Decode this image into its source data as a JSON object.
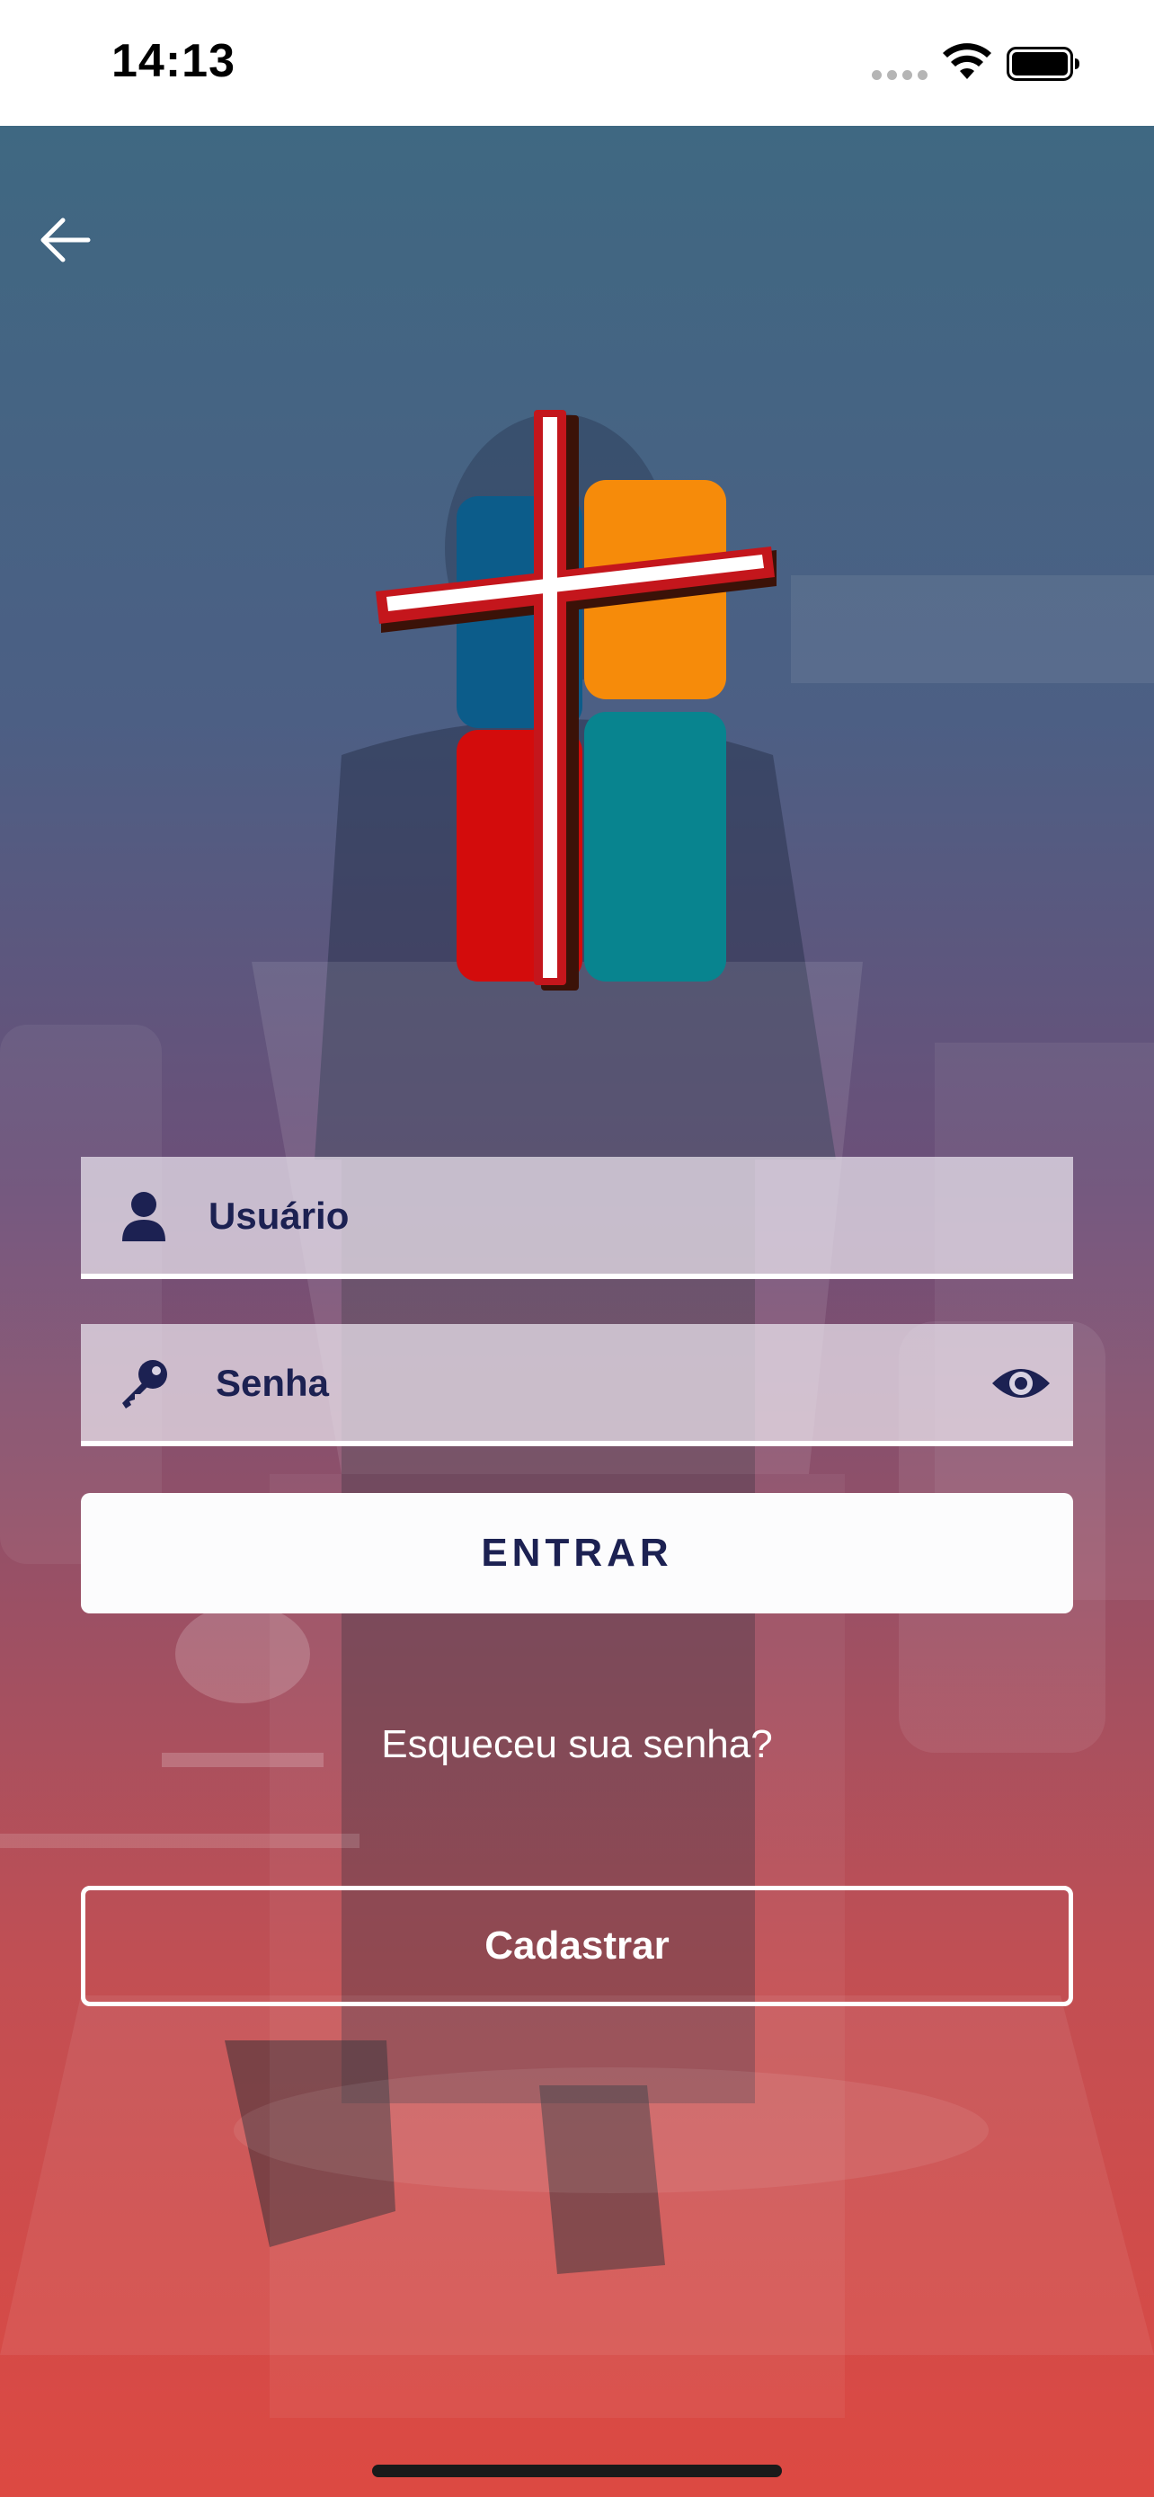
{
  "status_bar": {
    "time": "14:13"
  },
  "login": {
    "username_placeholder": "Usuário",
    "password_placeholder": "Senha",
    "enter_label": "ENTRAR",
    "forgot_label": "Esqueceu sua senha?",
    "register_label": "Cadastrar"
  },
  "icons": {
    "back": "arrow-left-icon",
    "user": "user-icon",
    "key": "key-icon",
    "eye": "eye-icon",
    "wifi": "wifi-icon",
    "battery": "battery-icon"
  },
  "colors": {
    "primary_text": "#1c2152",
    "gradient_top": "#3f6882",
    "gradient_bottom": "#dd4942",
    "logo_blue": "#0c5c8a",
    "logo_orange": "#f68b0a",
    "logo_red": "#d30c0c",
    "logo_teal": "#08848f",
    "cross_red": "#c4161c"
  }
}
